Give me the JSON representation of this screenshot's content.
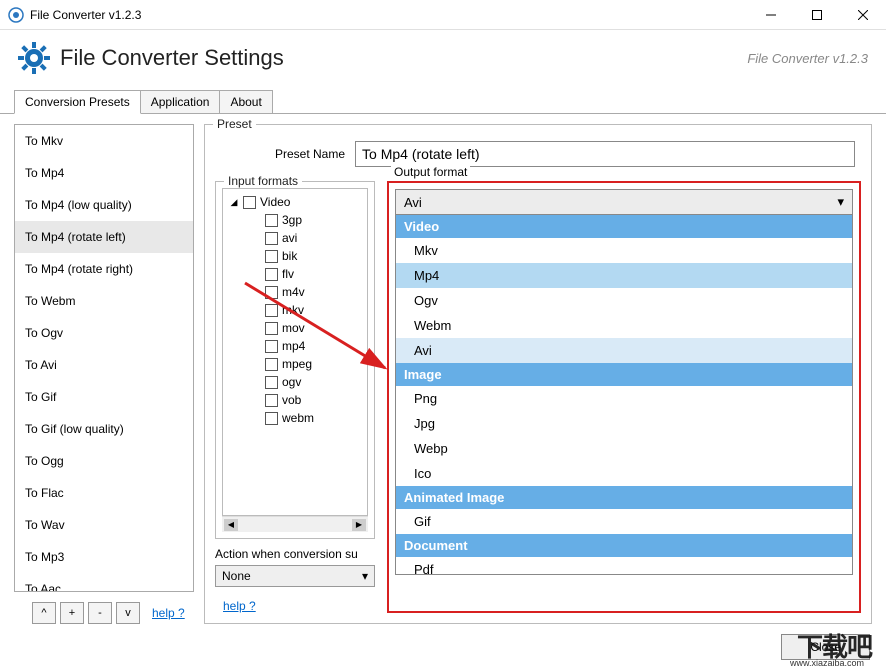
{
  "titlebar": {
    "appTitle": "File Converter v1.2.3"
  },
  "header": {
    "title": "File Converter Settings",
    "version": "File Converter v1.2.3"
  },
  "tabs": {
    "items": [
      {
        "label": "Conversion Presets",
        "active": true
      },
      {
        "label": "Application",
        "active": false
      },
      {
        "label": "About",
        "active": false
      }
    ]
  },
  "presets": {
    "items": [
      "To Mkv",
      "To Mp4",
      "To Mp4 (low quality)",
      "To Mp4 (rotate left)",
      "To Mp4 (rotate right)",
      "To Webm",
      "To Ogv",
      "To Avi",
      "To Gif",
      "To Gif (low quality)",
      "To Ogg",
      "To Flac",
      "To Wav",
      "To Mp3",
      "To Aac"
    ],
    "selected": "To Mp4 (rotate left)",
    "buttons": {
      "up": "^",
      "add": "+",
      "remove": "-",
      "down": "v"
    },
    "helpLabel": "help ?"
  },
  "preset": {
    "fieldsetLabel": "Preset",
    "nameLabel": "Preset Name",
    "nameValue": "To Mp4 (rotate left)"
  },
  "inputFormats": {
    "fieldsetLabel": "Input formats",
    "root": "Video",
    "items": [
      "3gp",
      "avi",
      "bik",
      "flv",
      "m4v",
      "mkv",
      "mov",
      "mp4",
      "mpeg",
      "ogv",
      "vob",
      "webm"
    ],
    "actionLabel": "Action when conversion su",
    "actionValue": "None",
    "helpLabel": "help ?"
  },
  "outputFormat": {
    "fieldsetLabel": "Output format",
    "selected": "Avi",
    "groups": [
      {
        "header": "Video",
        "options": [
          "Mkv",
          "Mp4",
          "Ogv",
          "Webm",
          "Avi"
        ]
      },
      {
        "header": "Image",
        "options": [
          "Png",
          "Jpg",
          "Webp",
          "Ico"
        ]
      },
      {
        "header": "Animated Image",
        "options": [
          "Gif"
        ]
      },
      {
        "header": "Document",
        "options": [
          "Pdf"
        ]
      }
    ],
    "highlighted": "Mp4",
    "selectedInList": "Avi"
  },
  "footer": {
    "closeLabel": "Close"
  },
  "watermark": {
    "text": "下载吧",
    "url": "www.xiazaiba.com"
  }
}
